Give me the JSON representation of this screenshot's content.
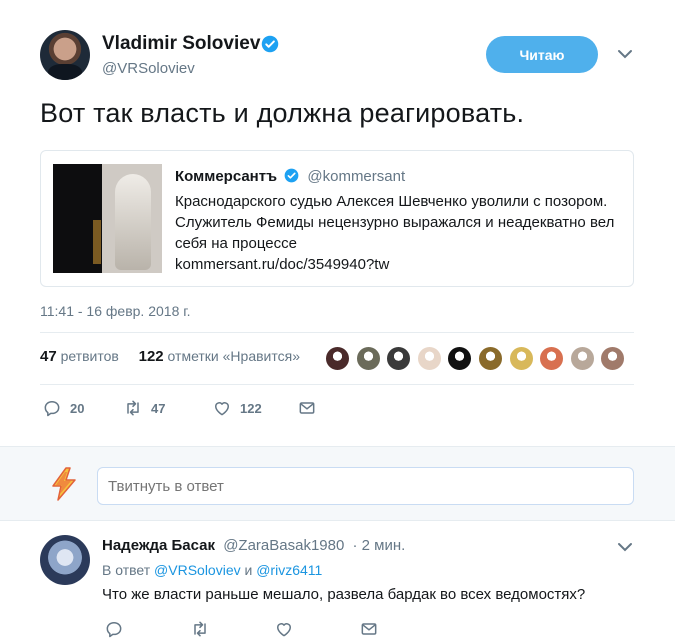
{
  "tweet": {
    "author_name": "Vladimir Soloviev",
    "author_handle": "@VRSoloviev",
    "follow_label": "Читаю",
    "text": "Вот так власть и должна реагировать.",
    "card": {
      "source_name": "Коммерсантъ",
      "source_handle": "@kommersant",
      "text": "Краснодарского судью Алексея Шевченко уволили с позором. Служитель Фемиды нецензурно выражался и неадекватно вел себя на процессе",
      "link": "kommersant.ru/doc/3549940?tw"
    },
    "timestamp": "11:41 - 16 февр. 2018 г.",
    "retweets_count": "47",
    "retweets_label": "ретвитов",
    "likes_count": "122",
    "likes_label": "отметки «Нравится»",
    "liker_colors": [
      "#4a2a2a",
      "#6b6b5a",
      "#3a3a3a",
      "#e8d6c8",
      "#111111",
      "#8a6a2a",
      "#d8b85a",
      "#d87050",
      "#b8a89a",
      "#a07a6a"
    ],
    "actions": {
      "reply_count": "20",
      "retweet_count": "47",
      "like_count": "122"
    }
  },
  "reply_box": {
    "placeholder": "Твитнуть в ответ"
  },
  "reply": {
    "author_name": "Надежда Басак",
    "author_handle": "@ZaraBasak1980",
    "time": "· 2 мин.",
    "in_reply_prefix": "В ответ",
    "mention1": "@VRSoloviev",
    "mention2": "@rivz6411",
    "text": "Что же власти раньше мешало, развела бардак во всех ведомостях?"
  },
  "colors": {
    "accent": "#1da1f2",
    "follow_button": "#4fb0ec",
    "muted_text": "#657786"
  }
}
